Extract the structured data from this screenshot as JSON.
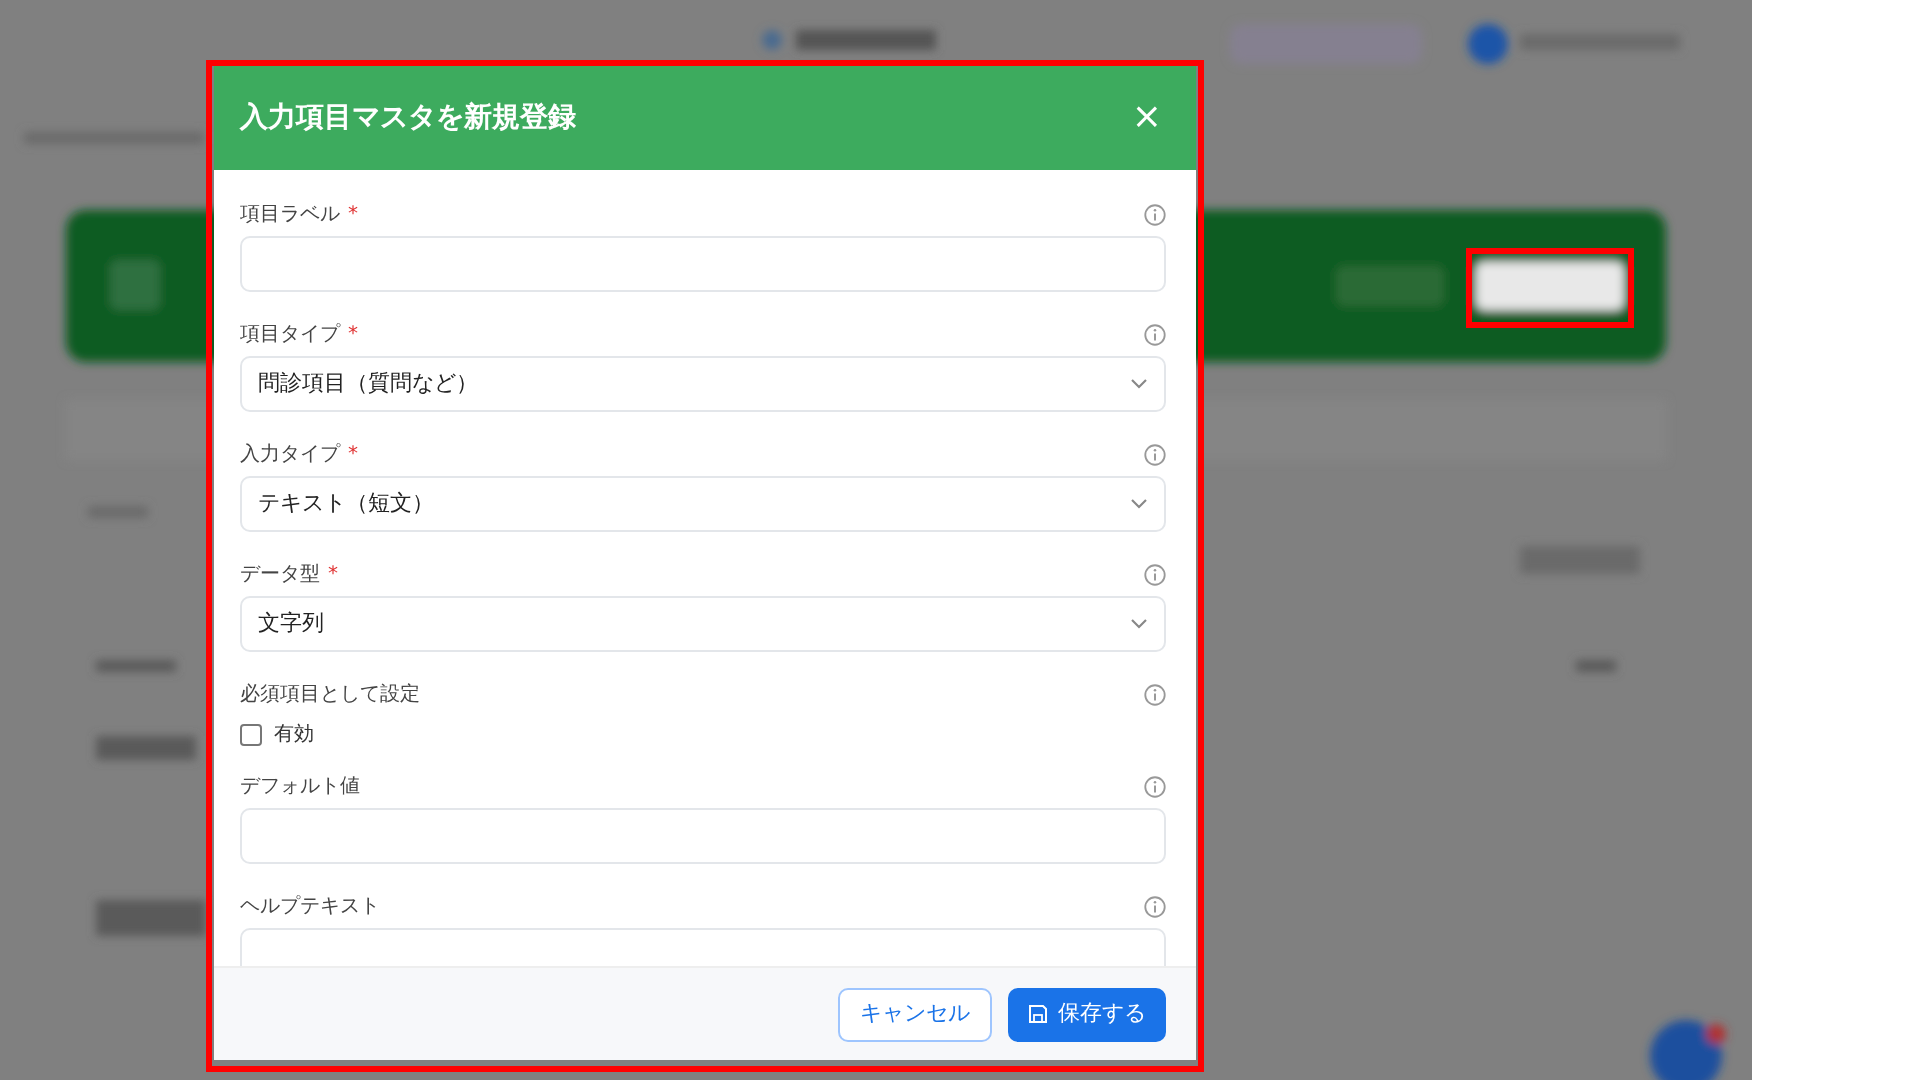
{
  "modal": {
    "title": "入力項目マスタを新規登録",
    "close": "×",
    "fields": [
      {
        "kind": "text",
        "label": "項目ラベル",
        "required_mark": "*"
      },
      {
        "kind": "select",
        "label": "項目タイプ",
        "required_mark": "*",
        "value": "問診項目（質問など）"
      },
      {
        "kind": "select",
        "label": "入力タイプ",
        "required_mark": "*",
        "value": "テキスト（短文）"
      },
      {
        "kind": "select",
        "label": "データ型",
        "required_mark": "*",
        "value": "文字列"
      },
      {
        "kind": "checkbox",
        "label": "必須項目として設定",
        "option": "有効",
        "checked": false
      },
      {
        "kind": "text",
        "label": "デフォルト値"
      },
      {
        "kind": "text",
        "label": "ヘルプテキスト"
      }
    ],
    "buttons": [
      {
        "kind": "outline",
        "label": "キャンセル"
      },
      {
        "kind": "primary",
        "label": "保存する"
      }
    ]
  }
}
